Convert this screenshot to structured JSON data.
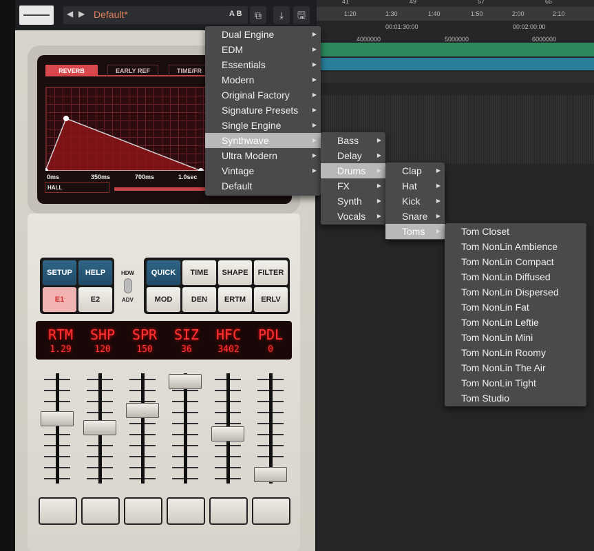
{
  "plugin": {
    "preset_name": "Default*",
    "ab_label": "A B",
    "tabs": [
      "REVERB",
      "EARLY REF",
      "TIME/FR"
    ],
    "time_labels": [
      "0ms",
      "350ms",
      "700ms",
      "1.0sec"
    ],
    "algorithm": "HALL",
    "keys_left": [
      "SETUP",
      "HELP",
      "E1",
      "E2"
    ],
    "toggle": {
      "top": "HDW",
      "bottom": "ADV"
    },
    "keys_right": [
      "QUICK",
      "TIME",
      "SHAPE",
      "FILTER",
      "MOD",
      "DEN",
      "ERTM",
      "ERLV"
    ],
    "lcd": [
      {
        "name": "RTM",
        "value": "1.29"
      },
      {
        "name": "SHP",
        "value": "120"
      },
      {
        "name": "SPR",
        "value": "150"
      },
      {
        "name": "SIZ",
        "value": "36"
      },
      {
        "name": "HFC",
        "value": "3402"
      },
      {
        "name": "PDL",
        "value": "0"
      }
    ],
    "fader_levels": [
      0.59,
      0.5,
      0.67,
      0.95,
      0.44,
      0.05
    ],
    "accent": "#d8484c"
  },
  "daw": {
    "bars": [
      "41",
      "49",
      "57",
      "65"
    ],
    "times": [
      "1:20",
      "1:30",
      "1:40",
      "1:50",
      "2:00",
      "2:10"
    ],
    "timecodes": [
      "00:01:30:00",
      "00:02:00:00"
    ],
    "samples": [
      "4000000",
      "5000000",
      "6000000"
    ],
    "track_colors": [
      "#2c8a5e",
      "#2a7f9a"
    ]
  },
  "menus": {
    "categories": [
      "Dual Engine",
      "EDM",
      "Essentials",
      "Modern",
      "Original Factory",
      "Signature Presets",
      "Single Engine",
      "Synthwave",
      "Ultra Modern",
      "Vintage",
      "Default"
    ],
    "synthwave": [
      "Bass",
      "Delay",
      "Drums",
      "FX",
      "Synth",
      "Vocals"
    ],
    "drums": [
      "Clap",
      "Hat",
      "Kick",
      "Snare",
      "Toms"
    ],
    "toms": [
      "Tom Closet",
      "Tom NonLin Ambience",
      "Tom NonLin Compact",
      "Tom NonLin Diffused",
      "Tom NonLin Dispersed",
      "Tom NonLin Fat",
      "Tom NonLin Leftie",
      "Tom NonLin Mini",
      "Tom NonLin Roomy",
      "Tom NonLin The Air",
      "Tom NonLin Tight",
      "Tom Studio"
    ]
  }
}
